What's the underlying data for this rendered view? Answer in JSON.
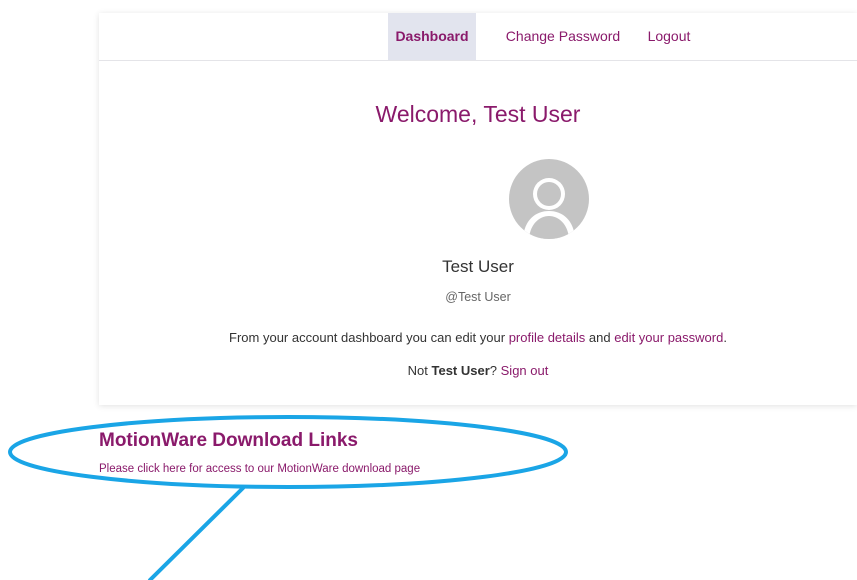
{
  "nav": {
    "tabs": [
      {
        "label": "Dashboard",
        "active": true
      },
      {
        "label": "Change Password",
        "active": false
      },
      {
        "label": "Logout",
        "active": false
      }
    ]
  },
  "dashboard": {
    "welcome": "Welcome, Test User",
    "avatar_icon": "default-user-avatar-icon",
    "user_name": "Test User",
    "user_handle": "@Test User",
    "account_text_prefix": "From your account dashboard you can edit your ",
    "profile_details_link": "profile details",
    "account_text_and": " and ",
    "edit_password_link": "edit your password",
    "account_text_suffix": ".",
    "not_prefix": "Not ",
    "not_user": "Test User",
    "not_suffix": "? ",
    "sign_out_link": "Sign out"
  },
  "downloads": {
    "title": "MotionWare Download Links",
    "link_text": "Please click here for access to our MotionWare download page"
  },
  "annotation": {
    "color": "#1aa5e6"
  },
  "colors": {
    "accent": "#8a1a6b",
    "active_tab_bg": "#e2e4ee"
  }
}
